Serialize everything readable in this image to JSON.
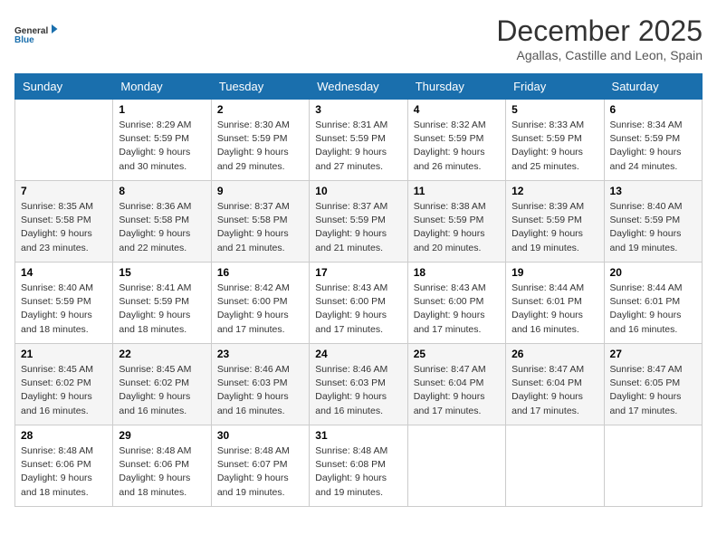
{
  "logo": {
    "line1": "General",
    "line2": "Blue"
  },
  "title": "December 2025",
  "subtitle": "Agallas, Castille and Leon, Spain",
  "days_of_week": [
    "Sunday",
    "Monday",
    "Tuesday",
    "Wednesday",
    "Thursday",
    "Friday",
    "Saturday"
  ],
  "weeks": [
    [
      {
        "num": "",
        "info": ""
      },
      {
        "num": "1",
        "info": "Sunrise: 8:29 AM\nSunset: 5:59 PM\nDaylight: 9 hours\nand 30 minutes."
      },
      {
        "num": "2",
        "info": "Sunrise: 8:30 AM\nSunset: 5:59 PM\nDaylight: 9 hours\nand 29 minutes."
      },
      {
        "num": "3",
        "info": "Sunrise: 8:31 AM\nSunset: 5:59 PM\nDaylight: 9 hours\nand 27 minutes."
      },
      {
        "num": "4",
        "info": "Sunrise: 8:32 AM\nSunset: 5:59 PM\nDaylight: 9 hours\nand 26 minutes."
      },
      {
        "num": "5",
        "info": "Sunrise: 8:33 AM\nSunset: 5:59 PM\nDaylight: 9 hours\nand 25 minutes."
      },
      {
        "num": "6",
        "info": "Sunrise: 8:34 AM\nSunset: 5:59 PM\nDaylight: 9 hours\nand 24 minutes."
      }
    ],
    [
      {
        "num": "7",
        "info": "Sunrise: 8:35 AM\nSunset: 5:58 PM\nDaylight: 9 hours\nand 23 minutes."
      },
      {
        "num": "8",
        "info": "Sunrise: 8:36 AM\nSunset: 5:58 PM\nDaylight: 9 hours\nand 22 minutes."
      },
      {
        "num": "9",
        "info": "Sunrise: 8:37 AM\nSunset: 5:58 PM\nDaylight: 9 hours\nand 21 minutes."
      },
      {
        "num": "10",
        "info": "Sunrise: 8:37 AM\nSunset: 5:59 PM\nDaylight: 9 hours\nand 21 minutes."
      },
      {
        "num": "11",
        "info": "Sunrise: 8:38 AM\nSunset: 5:59 PM\nDaylight: 9 hours\nand 20 minutes."
      },
      {
        "num": "12",
        "info": "Sunrise: 8:39 AM\nSunset: 5:59 PM\nDaylight: 9 hours\nand 19 minutes."
      },
      {
        "num": "13",
        "info": "Sunrise: 8:40 AM\nSunset: 5:59 PM\nDaylight: 9 hours\nand 19 minutes."
      }
    ],
    [
      {
        "num": "14",
        "info": "Sunrise: 8:40 AM\nSunset: 5:59 PM\nDaylight: 9 hours\nand 18 minutes."
      },
      {
        "num": "15",
        "info": "Sunrise: 8:41 AM\nSunset: 5:59 PM\nDaylight: 9 hours\nand 18 minutes."
      },
      {
        "num": "16",
        "info": "Sunrise: 8:42 AM\nSunset: 6:00 PM\nDaylight: 9 hours\nand 17 minutes."
      },
      {
        "num": "17",
        "info": "Sunrise: 8:43 AM\nSunset: 6:00 PM\nDaylight: 9 hours\nand 17 minutes."
      },
      {
        "num": "18",
        "info": "Sunrise: 8:43 AM\nSunset: 6:00 PM\nDaylight: 9 hours\nand 17 minutes."
      },
      {
        "num": "19",
        "info": "Sunrise: 8:44 AM\nSunset: 6:01 PM\nDaylight: 9 hours\nand 16 minutes."
      },
      {
        "num": "20",
        "info": "Sunrise: 8:44 AM\nSunset: 6:01 PM\nDaylight: 9 hours\nand 16 minutes."
      }
    ],
    [
      {
        "num": "21",
        "info": "Sunrise: 8:45 AM\nSunset: 6:02 PM\nDaylight: 9 hours\nand 16 minutes."
      },
      {
        "num": "22",
        "info": "Sunrise: 8:45 AM\nSunset: 6:02 PM\nDaylight: 9 hours\nand 16 minutes."
      },
      {
        "num": "23",
        "info": "Sunrise: 8:46 AM\nSunset: 6:03 PM\nDaylight: 9 hours\nand 16 minutes."
      },
      {
        "num": "24",
        "info": "Sunrise: 8:46 AM\nSunset: 6:03 PM\nDaylight: 9 hours\nand 16 minutes."
      },
      {
        "num": "25",
        "info": "Sunrise: 8:47 AM\nSunset: 6:04 PM\nDaylight: 9 hours\nand 17 minutes."
      },
      {
        "num": "26",
        "info": "Sunrise: 8:47 AM\nSunset: 6:04 PM\nDaylight: 9 hours\nand 17 minutes."
      },
      {
        "num": "27",
        "info": "Sunrise: 8:47 AM\nSunset: 6:05 PM\nDaylight: 9 hours\nand 17 minutes."
      }
    ],
    [
      {
        "num": "28",
        "info": "Sunrise: 8:48 AM\nSunset: 6:06 PM\nDaylight: 9 hours\nand 18 minutes."
      },
      {
        "num": "29",
        "info": "Sunrise: 8:48 AM\nSunset: 6:06 PM\nDaylight: 9 hours\nand 18 minutes."
      },
      {
        "num": "30",
        "info": "Sunrise: 8:48 AM\nSunset: 6:07 PM\nDaylight: 9 hours\nand 19 minutes."
      },
      {
        "num": "31",
        "info": "Sunrise: 8:48 AM\nSunset: 6:08 PM\nDaylight: 9 hours\nand 19 minutes."
      },
      {
        "num": "",
        "info": ""
      },
      {
        "num": "",
        "info": ""
      },
      {
        "num": "",
        "info": ""
      }
    ]
  ]
}
